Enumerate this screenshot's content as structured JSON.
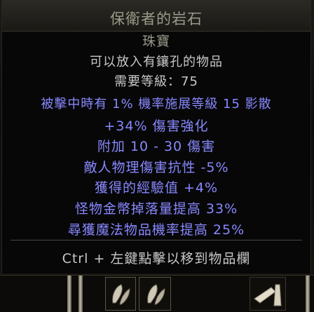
{
  "tooltip": {
    "item_name": "保衛者的岩石",
    "item_type": "珠寶",
    "description": "可以放入有鑲孔的物品",
    "requirement": "需要等級：75",
    "mods": [
      "被擊中時有 1% 機率施展等級 15 影散",
      "+34% 傷害強化",
      "附加 10 - 30 傷害",
      "敵人物理傷害抗性 -5%",
      "獲得的經驗值 +4%",
      "怪物金幣掉落量提高 33%",
      "尋獲魔法物品機率提高 25%"
    ],
    "hint": "Ctrl + 左鍵點擊以移到物品欄"
  },
  "colors": {
    "name": "#9c9a8a",
    "base_text": "#c8c8c8",
    "magic_mod": "#8888ff",
    "background": "#060608"
  },
  "icons": {
    "slot_1": "jewel-icon",
    "slot_2": "jewel-icon",
    "slot_3": "skill-gem-icon"
  }
}
